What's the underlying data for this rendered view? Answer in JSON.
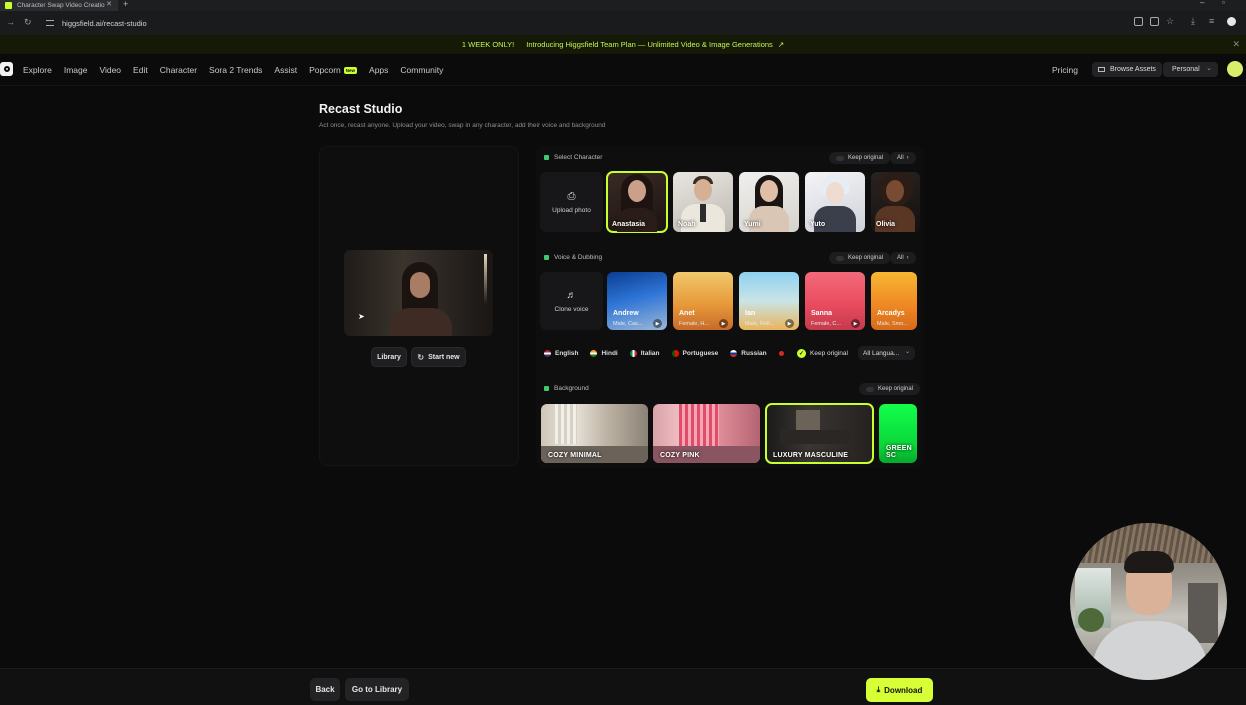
{
  "browser": {
    "tab_title": "Character Swap Video Creatio",
    "url": "higgsfield.ai/recast-studio"
  },
  "promo": {
    "tag": "1 WEEK ONLY!",
    "text": "Introducing Higgsfield Team Plan — Unlimited Video & Image Generations",
    "arrow": "↗"
  },
  "nav": {
    "links": [
      "Explore",
      "Image",
      "Video",
      "Edit",
      "Character",
      "Sora 2 Trends",
      "Assist",
      "Popcorn",
      "Apps",
      "Community"
    ],
    "popcorn_badge": "New",
    "pricing": "Pricing",
    "browse_assets": "Browse Assets",
    "workspace": "Personal"
  },
  "page": {
    "title": "Recast Studio",
    "subtitle": "Act once, recast anyone. Upload your video, swap in any character, add their voice and background"
  },
  "preview": {
    "library_button": "Library",
    "start_new_button": "Start new"
  },
  "character": {
    "section_label": "Select Character",
    "keep_original": "Keep original",
    "all": "All",
    "upload": "Upload photo",
    "items": [
      {
        "name": "Anastasia",
        "selected": true
      },
      {
        "name": "Noah",
        "selected": false
      },
      {
        "name": "Yumi",
        "selected": false
      },
      {
        "name": "Yuto",
        "selected": false
      },
      {
        "name": "Olivia",
        "selected": false
      }
    ]
  },
  "voice": {
    "section_label": "Voice & Dubbing",
    "keep_original": "Keep original",
    "all": "All",
    "clone": "Clone voice",
    "items": [
      {
        "name": "Andrew",
        "meta": "Male, Cas..."
      },
      {
        "name": "Anet",
        "meta": "Female, H..."
      },
      {
        "name": "Ian",
        "meta": "Male, Refl..."
      },
      {
        "name": "Sanna",
        "meta": "Female, C..."
      },
      {
        "name": "Arcadys",
        "meta": "Male, Smo..."
      }
    ]
  },
  "languages": {
    "items": [
      "English",
      "Hindi",
      "Italian",
      "Portuguese",
      "Russian"
    ],
    "keep_original": "Keep original",
    "all_languages": "All Langua..."
  },
  "background": {
    "section_label": "Background",
    "keep_original": "Keep original",
    "items": [
      {
        "name": "COZY MINIMAL",
        "selected": false
      },
      {
        "name": "COZY PINK",
        "selected": false
      },
      {
        "name": "LUXURY MASCULINE",
        "selected": true
      },
      {
        "name": "GREEN SC",
        "selected": false
      }
    ]
  },
  "footer": {
    "back": "Back",
    "go_to_library": "Go to Library",
    "download": "Download"
  },
  "colors": {
    "accent": "#d6ff36",
    "background": "#0b0b0c",
    "section_dot": "#3fc96e"
  }
}
